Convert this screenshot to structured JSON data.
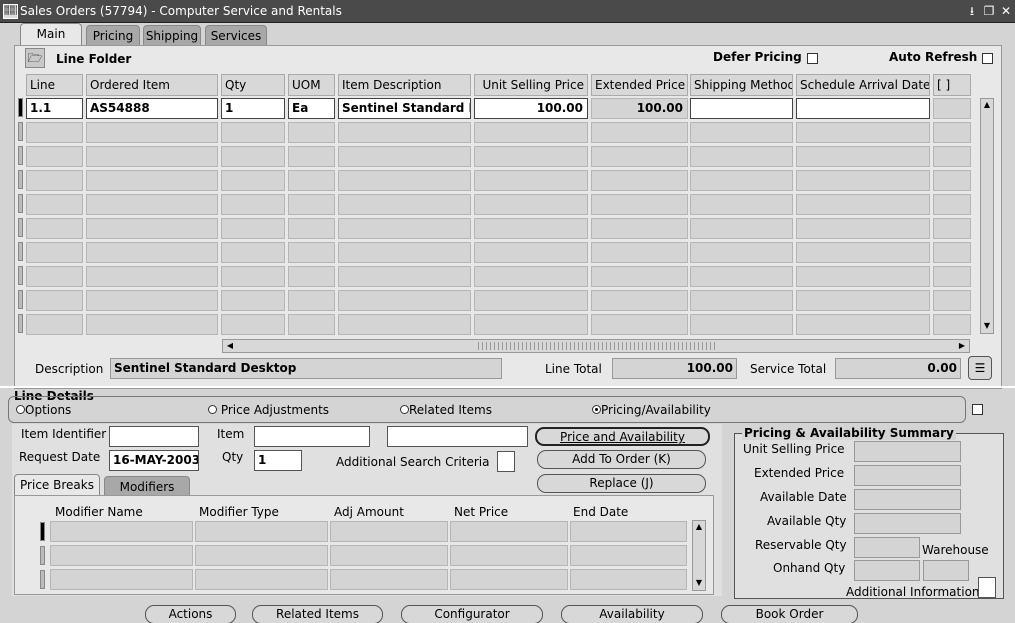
{
  "window": {
    "title": "Sales Orders (57794) - Computer Service and Rentals"
  },
  "tabs": [
    {
      "label": "Main"
    },
    {
      "label": "Pricing"
    },
    {
      "label": "Shipping"
    },
    {
      "label": "Services"
    }
  ],
  "main": {
    "line_folder_label": "Line Folder",
    "defer_pricing_label": "Defer Pricing",
    "auto_refresh_label": "Auto Refresh",
    "columns": [
      "Line",
      "Ordered Item",
      "Qty",
      "UOM",
      "Item Description",
      "Unit Selling Price",
      "Extended Price",
      "Shipping Method",
      "Schedule Arrival Date",
      "[ ]"
    ],
    "rows": [
      {
        "line": "1.1",
        "ordered_item": "AS54888",
        "qty": "1",
        "uom": "Ea",
        "item_description": "Sentinel Standard D",
        "unit_selling_price": "100.00",
        "extended_price": "100.00",
        "shipping_method": "",
        "schedule_arrival_date": ""
      }
    ],
    "description_label": "Description",
    "description_value": "Sentinel Standard Desktop",
    "line_total_label": "Line Total",
    "line_total_value": "100.00",
    "service_total_label": "Service Total",
    "service_total_value": "0.00"
  },
  "line_details": {
    "title": "Line Details",
    "options": [
      {
        "label": "Options",
        "selected": false
      },
      {
        "label": "Price Adjustments",
        "selected": false
      },
      {
        "label": "Related Items",
        "selected": false
      },
      {
        "label": "Pricing/Availability",
        "selected": true
      }
    ]
  },
  "search": {
    "item_identifier_label": "Item Identifier",
    "item_label": "Item",
    "request_date_label": "Request Date",
    "request_date_value": "16-MAY-2003",
    "qty_label": "Qty",
    "qty_value": "1",
    "additional_search_label": "Additional Search Criteria",
    "price_availability_button": "Price and Availability",
    "add_to_order_button": "Add To Order (K)",
    "replace_button": "Replace (J)"
  },
  "summary": {
    "title": "Pricing & Availability Summary",
    "unit_selling_price_label": "Unit Selling Price",
    "extended_price_label": "Extended Price",
    "available_date_label": "Available Date",
    "available_qty_label": "Available Qty",
    "reservable_qty_label": "Reservable Qty",
    "warehouse_label": "Warehouse",
    "onhand_qty_label": "Onhand Qty",
    "additional_info_label": "Additional Information"
  },
  "price_breaks": {
    "tabs": [
      {
        "label": "Price Breaks"
      },
      {
        "label": "Modifiers"
      }
    ],
    "columns": [
      "Modifier Name",
      "Modifier Type",
      "Adj Amount",
      "Net Price",
      "End Date"
    ]
  },
  "bottom_buttons": [
    {
      "label": "Actions"
    },
    {
      "label": "Related Items"
    },
    {
      "label": "Configurator"
    },
    {
      "label": "Availability"
    },
    {
      "label": "Book Order"
    }
  ]
}
